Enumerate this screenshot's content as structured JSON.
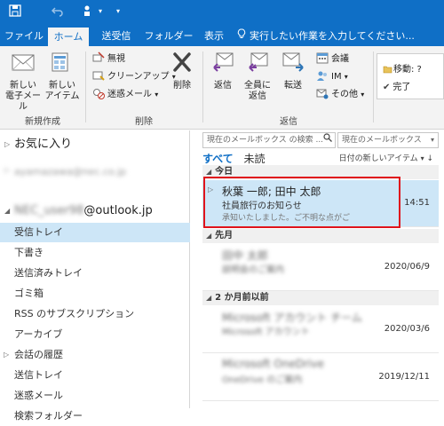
{
  "ribbon_tabs": [
    "ファイル",
    "ホーム",
    "送受信",
    "フォルダー",
    "表示"
  ],
  "tell_me": "実行したい作業を入力してください...",
  "ribbon": {
    "new_mail": "新しい\n電子メール",
    "new_items": "新しい\nアイテム",
    "group_new": "新規作成",
    "ignore": "無視",
    "cleanup": "クリーンアップ",
    "junk": "迷惑メール",
    "delete": "削除",
    "group_delete": "削除",
    "reply": "返信",
    "reply_all": "全員に\n返信",
    "forward": "転送",
    "meeting": "会議",
    "im": "IM",
    "more": "その他",
    "group_reply": "返信",
    "quick_move": "移動: ?",
    "quick_done": "完了"
  },
  "folders": {
    "favorites": "お気に入り",
    "account1": "ayamazawa@nec.co.jp",
    "account2_blur": "NEC_user98",
    "account2_domain": "@outlook.jp",
    "items": [
      {
        "label": "受信トレイ",
        "selected": true
      },
      {
        "label": "下書き"
      },
      {
        "label": "送信済みトレイ"
      },
      {
        "label": "ゴミ箱"
      },
      {
        "label": "RSS のサブスクリプション"
      },
      {
        "label": "アーカイブ"
      },
      {
        "label": "会話の履歴",
        "caret": true
      },
      {
        "label": "送信トレイ"
      },
      {
        "label": "迷惑メール"
      },
      {
        "label": "検索フォルダー"
      }
    ]
  },
  "mail_list": {
    "search_placeholder": "現在のメールボックス の検索 ...",
    "scope": "現在のメールボックス",
    "filter_all": "すべて",
    "filter_unread": "未読",
    "sort": "日付の新しいアイテム",
    "groups": [
      {
        "label": "今日",
        "mails": [
          {
            "from": "秋葉 一郎; 田中 太郎",
            "subject": "社員旅行のお知らせ",
            "preview": "承知いたしました。ご不明な点がご",
            "date": "14:51",
            "selected": true
          }
        ]
      },
      {
        "label": "先月",
        "mails": [
          {
            "from": "田中 太郎",
            "subject": "説明会のご案内",
            "preview": "",
            "date": "2020/06/9",
            "blurred": true
          }
        ]
      },
      {
        "label": "2 か月前以前",
        "mails": [
          {
            "from": "Microsoft アカウント チーム",
            "subject": "Microsoft アカウント",
            "preview": "",
            "date": "2020/03/6",
            "blurred": true
          },
          {
            "from": "Microsoft OneDrive",
            "subject": "OneDrive のご案内",
            "preview": "",
            "date": "2019/12/11",
            "blurred": true
          }
        ]
      }
    ]
  }
}
